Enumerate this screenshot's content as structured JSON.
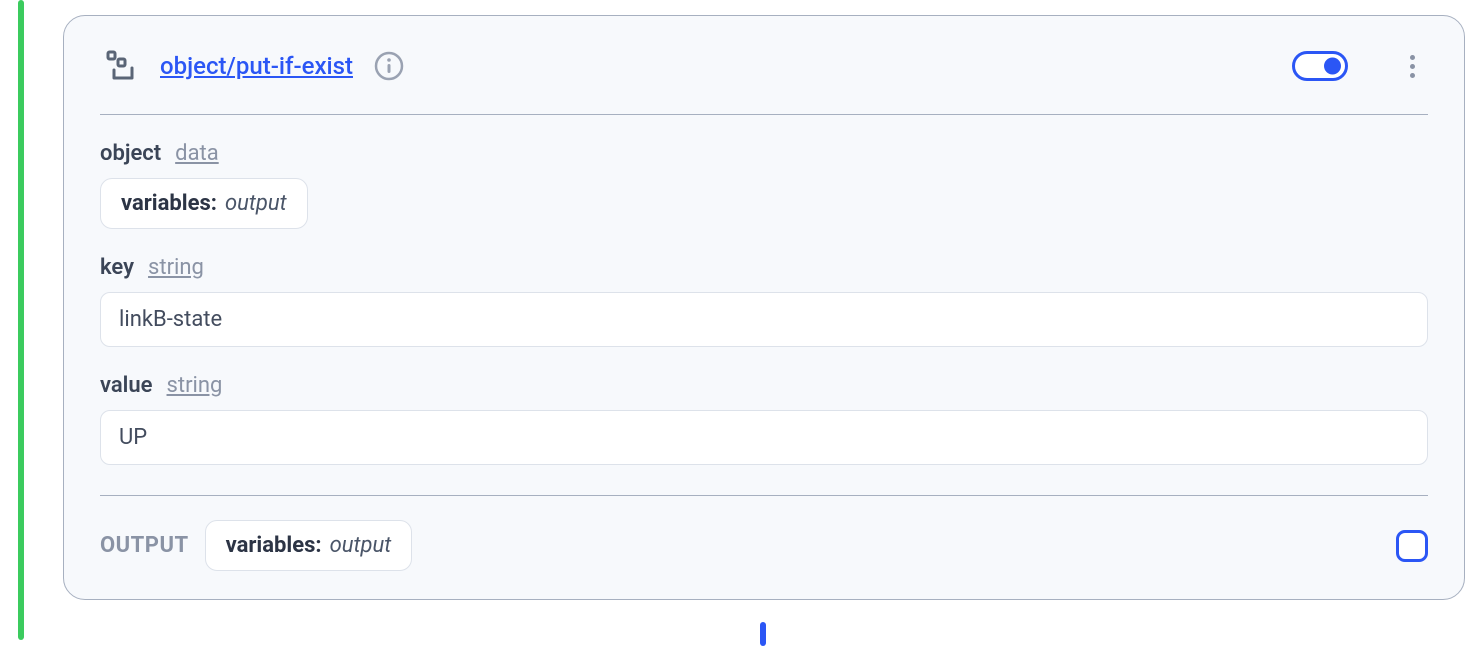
{
  "card": {
    "title": "object/put-if-exist",
    "toggle_on": true,
    "fields": {
      "object": {
        "label": "object",
        "type": "data",
        "chip_label": "variables:",
        "chip_value": "output"
      },
      "key": {
        "label": "key",
        "type": "string",
        "value": "linkB-state"
      },
      "value": {
        "label": "value",
        "type": "string",
        "value": "UP"
      }
    },
    "output": {
      "label": "OUTPUT",
      "chip_label": "variables:",
      "chip_value": "output"
    }
  }
}
